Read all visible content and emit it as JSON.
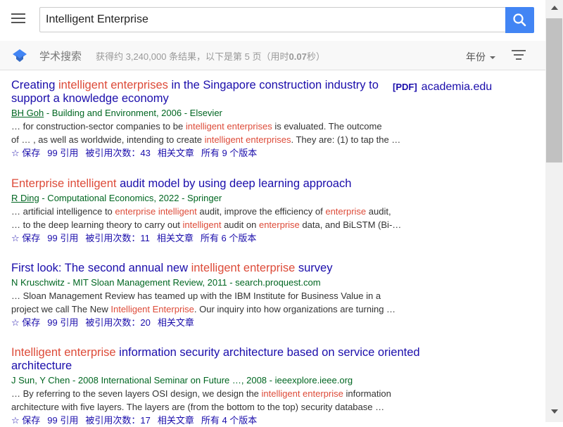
{
  "search": {
    "query": "Intelligent Enterprise"
  },
  "subbar": {
    "label": "学术搜索",
    "stats_prefix": "获得约 3,240,000 条结果，以下是第 5 页（用时",
    "stats_time": "0.07",
    "stats_suffix": "秒）",
    "year_label": "年份"
  },
  "colors": {
    "accent": "#4285f4",
    "link": "#1a0dab",
    "highlight": "#dd4b39",
    "source": "#006621"
  },
  "results": [
    {
      "title_parts": [
        {
          "t": "Creating ",
          "hl": false
        },
        {
          "t": "intelligent enterprises",
          "hl": true
        },
        {
          "t": " in the Singapore construction industry to support a knowledge economy",
          "hl": false
        }
      ],
      "pdf_tag": "[PDF]",
      "pdf_source": "academia.edu",
      "author_link": "BH Goh",
      "source": " - Building and Environment, 2006 - Elsevier",
      "snippet1": [
        {
          "t": "… for construction-sector companies to be ",
          "hl": false
        },
        {
          "t": "intelligent enterprises",
          "hl": true
        },
        {
          "t": " is evaluated. The outcome",
          "hl": false
        }
      ],
      "snippet2": [
        {
          "t": "of … , as well as worldwide, intending to create ",
          "hl": false
        },
        {
          "t": "intelligent enterprises",
          "hl": true
        },
        {
          "t": ". They are: (1) to tap the …",
          "hl": false
        }
      ],
      "actions": [
        "☆ 保存",
        "99 引用",
        "被引用次数：43",
        "相关文章",
        "所有 9 个版本"
      ]
    },
    {
      "title_parts": [
        {
          "t": "Enterprise intelligent",
          "hl": true
        },
        {
          "t": " audit model by using deep learning approach",
          "hl": false
        }
      ],
      "author_link": "R Ding",
      "source": " - Computational Economics, 2022 - Springer",
      "snippet1": [
        {
          "t": "… artificial intelligence to ",
          "hl": false
        },
        {
          "t": "enterprise intelligent",
          "hl": true
        },
        {
          "t": " audit, improve the efficiency of ",
          "hl": false
        },
        {
          "t": "enterprise",
          "hl": true
        },
        {
          "t": " audit,",
          "hl": false
        }
      ],
      "snippet2": [
        {
          "t": "… to the deep learning theory to carry out ",
          "hl": false
        },
        {
          "t": "intelligent",
          "hl": true
        },
        {
          "t": " audit on ",
          "hl": false
        },
        {
          "t": "enterprise",
          "hl": true
        },
        {
          "t": " data, and BiLSTM (Bi-…",
          "hl": false
        }
      ],
      "actions": [
        "☆ 保存",
        "99 引用",
        "被引用次数：11",
        "相关文章",
        "所有 6 个版本"
      ]
    },
    {
      "title_parts": [
        {
          "t": "First look: The second annual new ",
          "hl": false
        },
        {
          "t": "intelligent enterprise",
          "hl": true
        },
        {
          "t": " survey",
          "hl": false
        }
      ],
      "author_plain": "N Kruschwitz",
      "source": " - MIT Sloan Management Review, 2011 - search.proquest.com",
      "snippet1": [
        {
          "t": "… Sloan Management Review has teamed up with the IBM Institute for Business Value in a",
          "hl": false
        }
      ],
      "snippet2": [
        {
          "t": "project we call The New ",
          "hl": false
        },
        {
          "t": "Intelligent Enterprise",
          "hl": true
        },
        {
          "t": ". Our inquiry into how organizations are turning …",
          "hl": false
        }
      ],
      "actions": [
        "☆ 保存",
        "99 引用",
        "被引用次数：20",
        "相关文章"
      ]
    },
    {
      "title_parts": [
        {
          "t": "Intelligent enterprise",
          "hl": true
        },
        {
          "t": " information security architecture based on service oriented architecture",
          "hl": false
        }
      ],
      "author_plain": "J Sun, Y Chen",
      "source": " - 2008 International Seminar on Future …, 2008 - ieeexplore.ieee.org",
      "snippet1": [
        {
          "t": "… By referring to the seven layers OSI design, we design the ",
          "hl": false
        },
        {
          "t": "intelligent enterprise",
          "hl": true
        },
        {
          "t": " information",
          "hl": false
        }
      ],
      "snippet2": [
        {
          "t": "architecture with five layers. The layers are (from the bottom to the top) security database …",
          "hl": false
        }
      ],
      "actions": [
        "☆ 保存",
        "99 引用",
        "被引用次数：17",
        "相关文章",
        "所有 4 个版本"
      ]
    }
  ]
}
